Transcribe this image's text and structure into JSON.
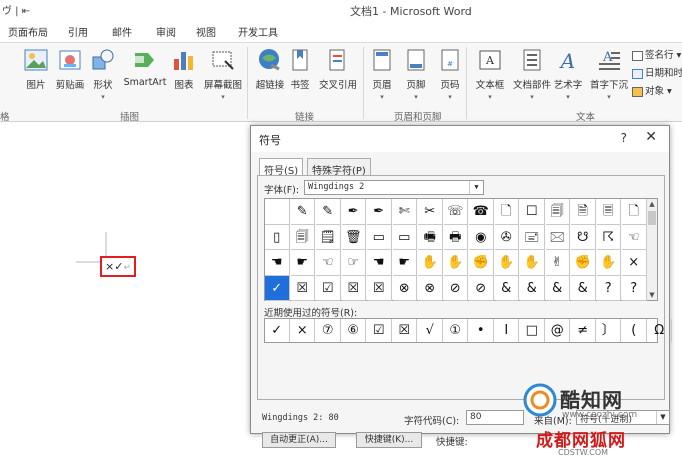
{
  "window": {
    "title": "文档1 - Microsoft Word",
    "quick_access": "ヴ |  ⇤"
  },
  "menu_tabs": [
    "页面布局",
    "引用",
    "邮件",
    "审阅",
    "视图",
    "开发工具"
  ],
  "ribbon": {
    "buttons": [
      {
        "label": "图片",
        "icon": "picture-icon"
      },
      {
        "label": "剪贴画",
        "icon": "clipart-icon"
      },
      {
        "label": "形状",
        "icon": "shapes-icon"
      },
      {
        "label": "SmartArt",
        "icon": "smartart-icon"
      },
      {
        "label": "图表",
        "icon": "chart-icon"
      },
      {
        "label": "屏幕截图",
        "icon": "screenshot-icon"
      },
      {
        "label": "超链接",
        "icon": "hyperlink-icon"
      },
      {
        "label": "书签",
        "icon": "bookmark-icon"
      },
      {
        "label": "交叉引用",
        "icon": "cross-reference-icon"
      },
      {
        "label": "页眉",
        "icon": "header-icon"
      },
      {
        "label": "页脚",
        "icon": "footer-icon"
      },
      {
        "label": "页码",
        "icon": "page-number-icon"
      },
      {
        "label": "文本框",
        "icon": "textbox-icon"
      },
      {
        "label": "文档部件",
        "icon": "quick-parts-icon"
      },
      {
        "label": "艺术字",
        "icon": "wordart-icon"
      },
      {
        "label": "首字下沉",
        "icon": "drop-cap-icon"
      }
    ],
    "side_items": [
      "签名行 ▾",
      "日期和时",
      "对象 ▾"
    ],
    "groups": [
      "插图",
      "链接",
      "页眉和页脚",
      "文本"
    ],
    "left_group_label": "格"
  },
  "document": {
    "inserted_text": "×✓",
    "para_mark": "↵"
  },
  "dialog": {
    "title": "符号",
    "help": "?",
    "close": "✕",
    "tabs": [
      "符号(S)",
      "特殊字符(P)"
    ],
    "font_label": "字体(F):",
    "font_value": "Wingdings 2",
    "symbols": [
      "",
      "✎",
      "✎",
      "✒",
      "✒",
      "✄",
      "✂",
      "☏",
      "☎",
      "🗋",
      "☐",
      "🗐",
      "🗎",
      "🗏",
      "🗋",
      "▯",
      "🗐",
      "🗒",
      "🗑",
      "▭",
      "▭",
      "🖷",
      "🖶",
      "◉",
      "✇",
      "🖃",
      "🖂",
      "☋",
      "☈",
      "☜",
      "☚",
      "☛",
      "☜",
      "☞",
      "☚",
      "☛",
      "✋",
      "✋",
      "✊",
      "✋",
      "✋",
      "✌",
      "✊",
      "✋",
      "×",
      "✓",
      "☒",
      "☑",
      "☒",
      "☒",
      "⊗",
      "⊗",
      "⊘",
      "⊘",
      "&",
      "&",
      "&",
      "&",
      "?",
      "?"
    ],
    "selected_index": 45,
    "recent_label": "近期使用过的符号(R):",
    "recent": [
      "✓",
      "×",
      "⑦",
      "⑥",
      "☑",
      "☒",
      "√",
      "①",
      "•",
      "I",
      "□",
      "@",
      "≠",
      "〕",
      "(",
      "Ω"
    ],
    "char_name": "Wingdings 2: 80",
    "code_label": "字符代码(C):",
    "code_value": "80",
    "from_label": "来自(M):",
    "from_value": "符号(十进制)",
    "autocorrect_btn": "自动更正(A)...",
    "shortcut_btn": "快捷键(K)...",
    "shortcut_label": "快捷键:"
  },
  "watermark": {
    "brand": "酷知网",
    "url": "www.coozhi.com",
    "brand2": "成都网狐网",
    "url2": "CDSTW.COM"
  }
}
